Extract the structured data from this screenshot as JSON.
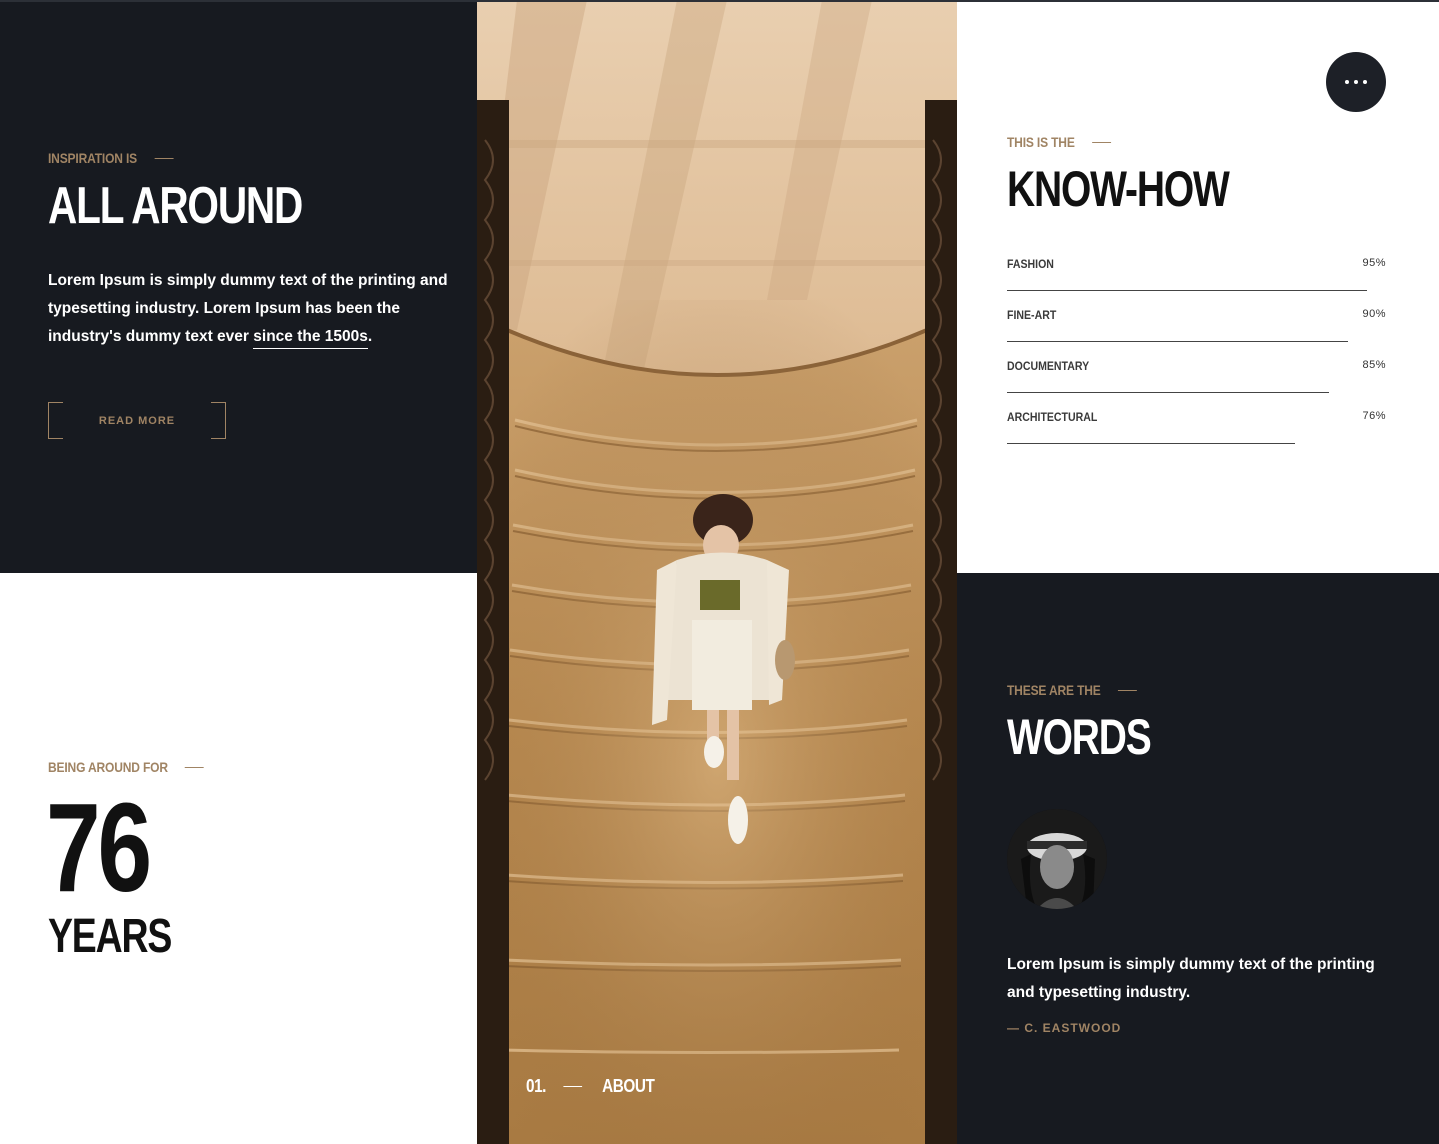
{
  "top_left": {
    "eyebrow": "INSPIRATION IS",
    "title": "ALL AROUND",
    "body_start": "Lorem Ipsum is simply dummy text of the printing and typesetting industry. Lorem Ipsum has been the industry's dummy text ever ",
    "body_link": "since the 1500s",
    "body_end": ".",
    "button": "READ MORE"
  },
  "bottom_left": {
    "eyebrow": "BEING AROUND FOR",
    "number": "76",
    "unit": "YEARS"
  },
  "image_panel": {
    "index": "01.",
    "label": "ABOUT"
  },
  "top_right": {
    "menu_icon": "more-horizontal-icon",
    "eyebrow": "THIS IS THE",
    "title": "KNOW-HOW",
    "skills": [
      {
        "name": "FASHION",
        "percent_label": "95%",
        "value": 95
      },
      {
        "name": "FINE-ART",
        "percent_label": "90%",
        "value": 90
      },
      {
        "name": "DOCUMENTARY",
        "percent_label": "85%",
        "value": 85
      },
      {
        "name": "ARCHITECTURAL",
        "percent_label": "76%",
        "value": 76
      }
    ]
  },
  "bottom_right": {
    "eyebrow": "THESE ARE THE",
    "title": "WORDS",
    "quote": "Lorem Ipsum is simply dummy text of the printing and typesetting industry.",
    "author": "— C. EASTWOOD"
  },
  "colors": {
    "dark_bg": "#171a20",
    "accent": "#a08464",
    "light_bg": "#ffffff"
  }
}
